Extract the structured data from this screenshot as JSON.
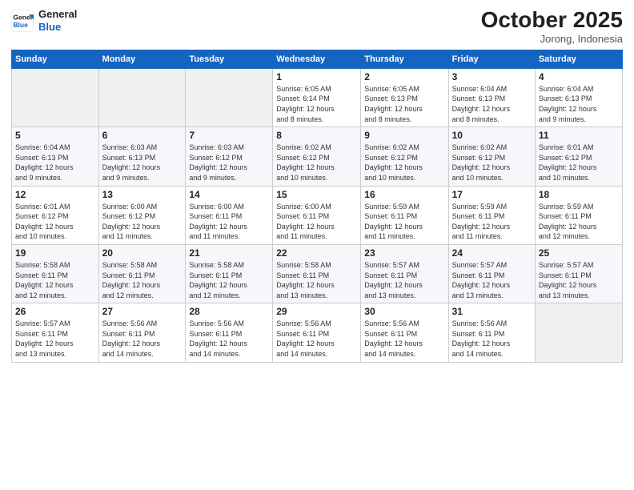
{
  "logo": {
    "line1": "General",
    "line2": "Blue"
  },
  "header": {
    "month": "October 2025",
    "location": "Jorong, Indonesia"
  },
  "weekdays": [
    "Sunday",
    "Monday",
    "Tuesday",
    "Wednesday",
    "Thursday",
    "Friday",
    "Saturday"
  ],
  "weeks": [
    [
      {
        "day": "",
        "info": ""
      },
      {
        "day": "",
        "info": ""
      },
      {
        "day": "",
        "info": ""
      },
      {
        "day": "1",
        "info": "Sunrise: 6:05 AM\nSunset: 6:14 PM\nDaylight: 12 hours\nand 8 minutes."
      },
      {
        "day": "2",
        "info": "Sunrise: 6:05 AM\nSunset: 6:13 PM\nDaylight: 12 hours\nand 8 minutes."
      },
      {
        "day": "3",
        "info": "Sunrise: 6:04 AM\nSunset: 6:13 PM\nDaylight: 12 hours\nand 8 minutes."
      },
      {
        "day": "4",
        "info": "Sunrise: 6:04 AM\nSunset: 6:13 PM\nDaylight: 12 hours\nand 9 minutes."
      }
    ],
    [
      {
        "day": "5",
        "info": "Sunrise: 6:04 AM\nSunset: 6:13 PM\nDaylight: 12 hours\nand 9 minutes."
      },
      {
        "day": "6",
        "info": "Sunrise: 6:03 AM\nSunset: 6:13 PM\nDaylight: 12 hours\nand 9 minutes."
      },
      {
        "day": "7",
        "info": "Sunrise: 6:03 AM\nSunset: 6:12 PM\nDaylight: 12 hours\nand 9 minutes."
      },
      {
        "day": "8",
        "info": "Sunrise: 6:02 AM\nSunset: 6:12 PM\nDaylight: 12 hours\nand 10 minutes."
      },
      {
        "day": "9",
        "info": "Sunrise: 6:02 AM\nSunset: 6:12 PM\nDaylight: 12 hours\nand 10 minutes."
      },
      {
        "day": "10",
        "info": "Sunrise: 6:02 AM\nSunset: 6:12 PM\nDaylight: 12 hours\nand 10 minutes."
      },
      {
        "day": "11",
        "info": "Sunrise: 6:01 AM\nSunset: 6:12 PM\nDaylight: 12 hours\nand 10 minutes."
      }
    ],
    [
      {
        "day": "12",
        "info": "Sunrise: 6:01 AM\nSunset: 6:12 PM\nDaylight: 12 hours\nand 10 minutes."
      },
      {
        "day": "13",
        "info": "Sunrise: 6:00 AM\nSunset: 6:12 PM\nDaylight: 12 hours\nand 11 minutes."
      },
      {
        "day": "14",
        "info": "Sunrise: 6:00 AM\nSunset: 6:11 PM\nDaylight: 12 hours\nand 11 minutes."
      },
      {
        "day": "15",
        "info": "Sunrise: 6:00 AM\nSunset: 6:11 PM\nDaylight: 12 hours\nand 11 minutes."
      },
      {
        "day": "16",
        "info": "Sunrise: 5:59 AM\nSunset: 6:11 PM\nDaylight: 12 hours\nand 11 minutes."
      },
      {
        "day": "17",
        "info": "Sunrise: 5:59 AM\nSunset: 6:11 PM\nDaylight: 12 hours\nand 11 minutes."
      },
      {
        "day": "18",
        "info": "Sunrise: 5:59 AM\nSunset: 6:11 PM\nDaylight: 12 hours\nand 12 minutes."
      }
    ],
    [
      {
        "day": "19",
        "info": "Sunrise: 5:58 AM\nSunset: 6:11 PM\nDaylight: 12 hours\nand 12 minutes."
      },
      {
        "day": "20",
        "info": "Sunrise: 5:58 AM\nSunset: 6:11 PM\nDaylight: 12 hours\nand 12 minutes."
      },
      {
        "day": "21",
        "info": "Sunrise: 5:58 AM\nSunset: 6:11 PM\nDaylight: 12 hours\nand 12 minutes."
      },
      {
        "day": "22",
        "info": "Sunrise: 5:58 AM\nSunset: 6:11 PM\nDaylight: 12 hours\nand 13 minutes."
      },
      {
        "day": "23",
        "info": "Sunrise: 5:57 AM\nSunset: 6:11 PM\nDaylight: 12 hours\nand 13 minutes."
      },
      {
        "day": "24",
        "info": "Sunrise: 5:57 AM\nSunset: 6:11 PM\nDaylight: 12 hours\nand 13 minutes."
      },
      {
        "day": "25",
        "info": "Sunrise: 5:57 AM\nSunset: 6:11 PM\nDaylight: 12 hours\nand 13 minutes."
      }
    ],
    [
      {
        "day": "26",
        "info": "Sunrise: 5:57 AM\nSunset: 6:11 PM\nDaylight: 12 hours\nand 13 minutes."
      },
      {
        "day": "27",
        "info": "Sunrise: 5:56 AM\nSunset: 6:11 PM\nDaylight: 12 hours\nand 14 minutes."
      },
      {
        "day": "28",
        "info": "Sunrise: 5:56 AM\nSunset: 6:11 PM\nDaylight: 12 hours\nand 14 minutes."
      },
      {
        "day": "29",
        "info": "Sunrise: 5:56 AM\nSunset: 6:11 PM\nDaylight: 12 hours\nand 14 minutes."
      },
      {
        "day": "30",
        "info": "Sunrise: 5:56 AM\nSunset: 6:11 PM\nDaylight: 12 hours\nand 14 minutes."
      },
      {
        "day": "31",
        "info": "Sunrise: 5:56 AM\nSunset: 6:11 PM\nDaylight: 12 hours\nand 14 minutes."
      },
      {
        "day": "",
        "info": ""
      }
    ]
  ]
}
